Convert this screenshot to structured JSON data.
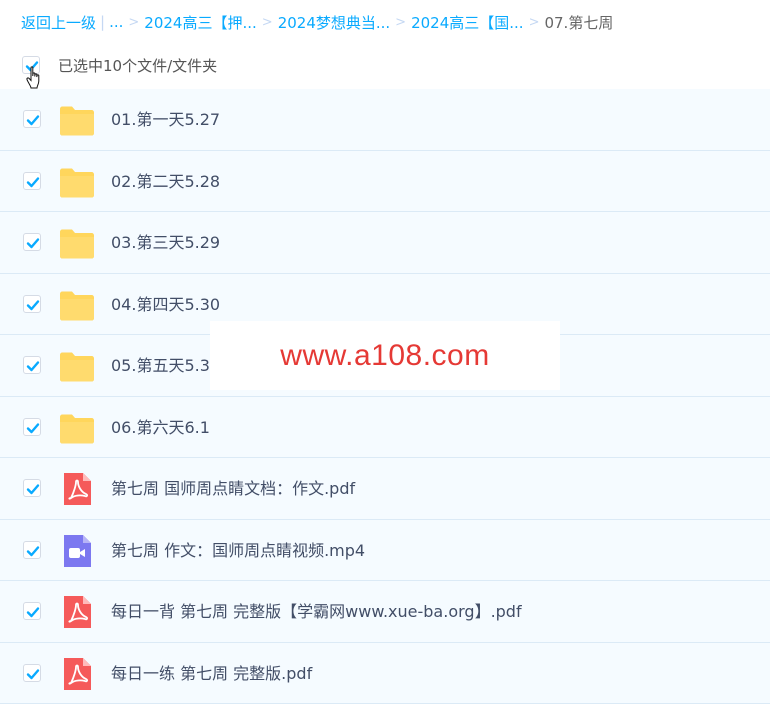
{
  "breadcrumb": {
    "back": "返回上一级",
    "ellipsis": "...",
    "crumbs": [
      "2024高三【押...",
      "2024梦想典当...",
      "2024高三【国..."
    ],
    "current": "07.第七周"
  },
  "selection": {
    "text": "已选中10个文件/文件夹",
    "checked": true
  },
  "files": [
    {
      "name": "01.第一天5.27",
      "type": "folder",
      "checked": true
    },
    {
      "name": "02.第二天5.28",
      "type": "folder",
      "checked": true
    },
    {
      "name": "03.第三天5.29",
      "type": "folder",
      "checked": true
    },
    {
      "name": "04.第四天5.30",
      "type": "folder",
      "checked": true
    },
    {
      "name": "05.第五天5.31",
      "type": "folder",
      "checked": true
    },
    {
      "name": "06.第六天6.1",
      "type": "folder",
      "checked": true
    },
    {
      "name": "第七周 国师周点睛文档：作文.pdf",
      "type": "pdf",
      "checked": true
    },
    {
      "name": "第七周 作文：国师周点睛视频.mp4",
      "type": "video",
      "checked": true
    },
    {
      "name": "每日一背 第七周 完整版【学霸网www.xue-ba.org】.pdf",
      "type": "pdf",
      "checked": true
    },
    {
      "name": "每日一练 第七周 完整版.pdf",
      "type": "pdf",
      "checked": true
    }
  ],
  "watermark": {
    "text": "www.a108.com"
  },
  "colors": {
    "accent": "#09aaff",
    "folder": "#ffd65c",
    "pdf": "#f55a5a",
    "video": "#7c78f0",
    "row_bg": "#f5fbff"
  }
}
